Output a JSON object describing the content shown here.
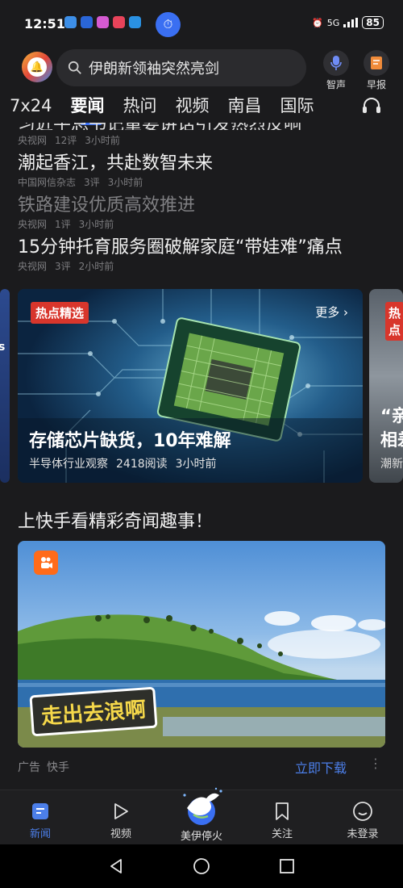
{
  "status": {
    "time": "12:51",
    "network": "5G",
    "battery": "85",
    "app_icon_colors": [
      "#3d8fe8",
      "#2a66d8",
      "#d55ad2",
      "#e8435a",
      "#2a91e3"
    ]
  },
  "header": {
    "search_placeholder": "伊朗新领袖突然亮剑",
    "voice_label": "智声",
    "morning_label": "早报"
  },
  "tabs": [
    {
      "label": "7x24",
      "active": false
    },
    {
      "label": "要闻",
      "active": true
    },
    {
      "label": "热问",
      "active": false
    },
    {
      "label": "视频",
      "active": false
    },
    {
      "label": "南昌",
      "active": false
    },
    {
      "label": "国际",
      "active": false
    }
  ],
  "news": [
    {
      "title": "潮起香江，共赴数智未来",
      "source": "中国网信杂志",
      "comments": "3评",
      "time": "3小时前",
      "read": false
    },
    {
      "title": "铁路建设优质高效推进",
      "source": "央视网",
      "comments": "1评",
      "time": "3小时前",
      "read": true
    },
    {
      "title": "15分钟托育服务圈破解家庭“带娃难”痛点",
      "source": "央视网",
      "comments": "3评",
      "time": "2小时前",
      "read": false
    }
  ],
  "partial_top": {
    "title": "习近平总书记重要讲话引发热烈反响",
    "source": "央视网",
    "comments": "12评",
    "time": "3小时前"
  },
  "carousel": {
    "left_edge_text": "s",
    "main": {
      "tag": "热点精选",
      "more": "更多",
      "title": "存储芯片缺货，10年难解",
      "source": "半导体行业观察",
      "reads": "2418阅读",
      "time": "3小时前"
    },
    "right": {
      "tag": "热点",
      "title_line1": "“亲",
      "title_line2": "相差",
      "meta": "潮新"
    }
  },
  "ad": {
    "heading": "上快手看精彩奇闻趣事！",
    "image_text": "走出去浪啊",
    "label": "广告",
    "advertiser": "快手",
    "cta": "立即下载",
    "more": "⋮"
  },
  "bottom_nav": [
    {
      "label": "新闻",
      "icon": "news-icon",
      "active": true
    },
    {
      "label": "视频",
      "icon": "play-icon",
      "active": false
    },
    {
      "label": "美伊停火",
      "icon": "dove-icon",
      "active": false
    },
    {
      "label": "关注",
      "icon": "bookmark-icon",
      "active": false
    },
    {
      "label": "未登录",
      "icon": "user-icon",
      "active": false
    }
  ],
  "accent": "#4c7fea",
  "tag_red": "#d8362c"
}
